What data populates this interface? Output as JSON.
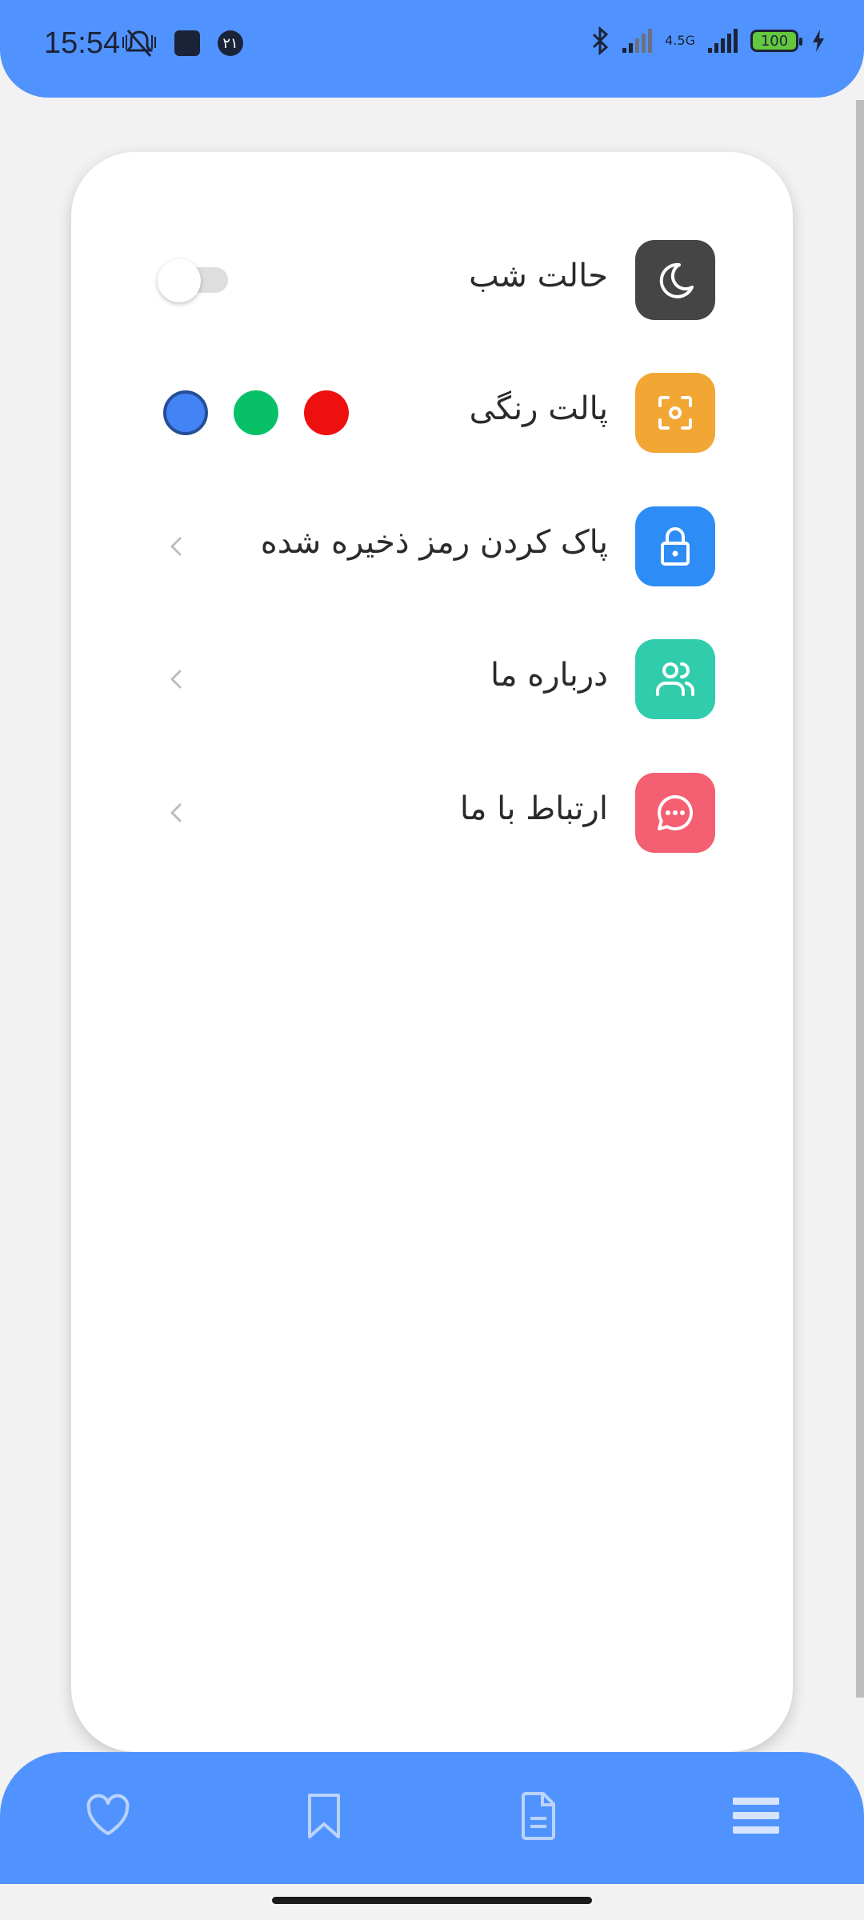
{
  "status_bar": {
    "time": "15:54",
    "badge_text": "۲۱",
    "network_label": "4.5G",
    "battery_level": "100"
  },
  "settings": {
    "items": [
      {
        "label": "حالت شب",
        "icon": "moon-icon",
        "icon_bg": "#454545",
        "control": "toggle",
        "toggle_on": false
      },
      {
        "label": "پالت رنگی",
        "icon": "focus-frame-icon",
        "icon_bg": "#f2a634",
        "control": "swatches",
        "swatches": [
          {
            "color": "#ee0f0f",
            "selected": false
          },
          {
            "color": "#08c068",
            "selected": false
          },
          {
            "color": "#4283f5",
            "selected": true
          }
        ]
      },
      {
        "label": "پاک کردن رمز ذخیره شده",
        "icon": "lock-icon",
        "icon_bg": "#2d8cf5",
        "control": "chevron"
      },
      {
        "label": "درباره ما",
        "icon": "users-icon",
        "icon_bg": "#31ccac",
        "control": "chevron"
      },
      {
        "label": "ارتباط با ما",
        "icon": "chat-icon",
        "icon_bg": "#f45f72",
        "control": "chevron"
      }
    ]
  },
  "bottom_nav": {
    "items": [
      "heart-icon",
      "bookmark-icon",
      "document-icon",
      "menu-icon"
    ],
    "active": "menu-icon"
  },
  "colors": {
    "accent": "#5193fe",
    "background": "#f2f2f2"
  }
}
